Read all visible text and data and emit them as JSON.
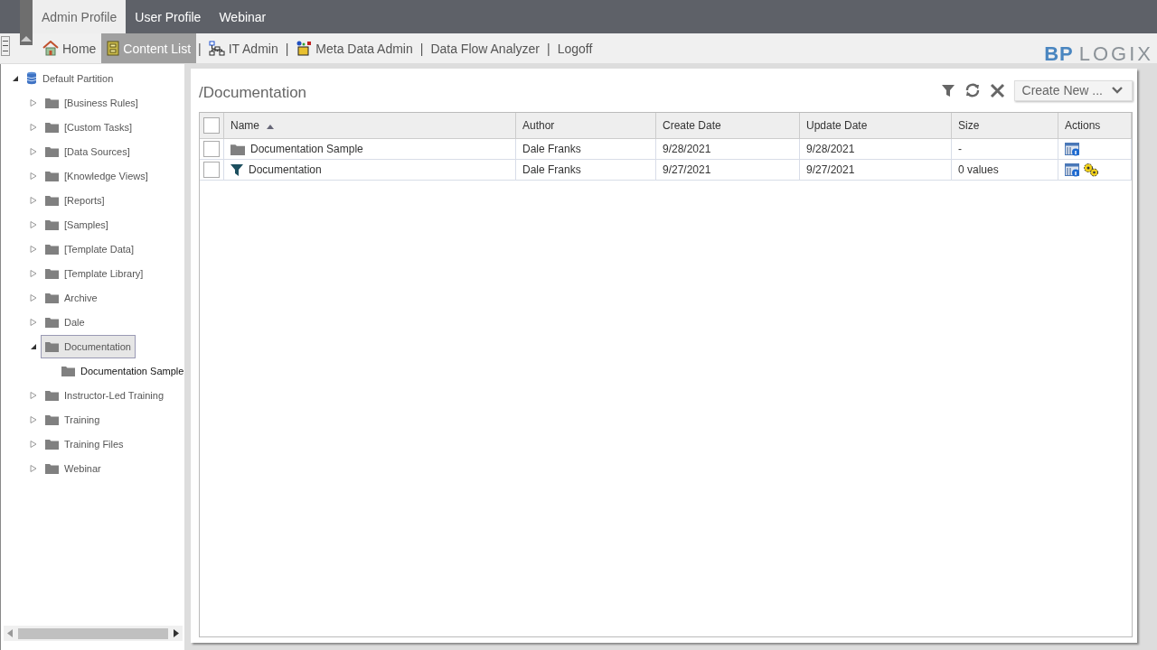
{
  "profile_tabs": [
    {
      "label": "Admin Profile",
      "selected": true
    },
    {
      "label": "User Profile",
      "selected": false
    },
    {
      "label": "Webinar",
      "selected": false
    }
  ],
  "nav_items": [
    {
      "label": "Home",
      "kind": "home",
      "selected": false
    },
    {
      "label": "Content List",
      "kind": "cabinet",
      "selected": true
    },
    {
      "label": "IT Admin",
      "kind": "network",
      "selected": false
    },
    {
      "label": "Meta Data Admin",
      "kind": "box",
      "selected": false
    },
    {
      "label": "Data Flow Analyzer",
      "kind": "plain",
      "selected": false
    },
    {
      "label": "Logoff",
      "kind": "plain",
      "selected": false
    }
  ],
  "nav_separator": "|",
  "logo": {
    "first": "BP",
    "second": "LOGIX"
  },
  "tree": {
    "label": "Default Partition",
    "expanded": true,
    "children": [
      {
        "label": "[Business Rules]",
        "expanded": false,
        "selected": false
      },
      {
        "label": "[Custom Tasks]",
        "expanded": false,
        "selected": false
      },
      {
        "label": "[Data Sources]",
        "expanded": false,
        "selected": false
      },
      {
        "label": "[Knowledge Views]",
        "expanded": false,
        "selected": false
      },
      {
        "label": "[Reports]",
        "expanded": false,
        "selected": false
      },
      {
        "label": "[Samples]",
        "expanded": false,
        "selected": false
      },
      {
        "label": "[Template Data]",
        "expanded": false,
        "selected": false
      },
      {
        "label": "[Template Library]",
        "expanded": false,
        "selected": false
      },
      {
        "label": "Archive",
        "expanded": false,
        "selected": false
      },
      {
        "label": "Dale",
        "expanded": false,
        "selected": false
      },
      {
        "label": "Documentation",
        "expanded": true,
        "selected": true,
        "children": [
          {
            "label": "Documentation Sample",
            "selected": false
          }
        ]
      },
      {
        "label": "Instructor-Led Training",
        "expanded": false,
        "selected": false
      },
      {
        "label": "Training",
        "expanded": false,
        "selected": false
      },
      {
        "label": "Training Files",
        "expanded": false,
        "selected": false
      },
      {
        "label": "Webinar",
        "expanded": false,
        "selected": false
      }
    ]
  },
  "content": {
    "path": "/Documentation",
    "create_button": "Create New ...",
    "select_all_checked": false,
    "columns": [
      {
        "label": "Name",
        "sorted": true
      },
      {
        "label": "Author",
        "sorted": false
      },
      {
        "label": "Create Date",
        "sorted": false
      },
      {
        "label": "Update Date",
        "sorted": false
      },
      {
        "label": "Size",
        "sorted": false
      },
      {
        "label": "Actions",
        "sorted": false
      }
    ],
    "rows": [
      {
        "checked": false,
        "kind": "folder",
        "name": "Documentation Sample",
        "author": "Dale Franks",
        "create_date": "9/28/2021",
        "update_date": "9/28/2021",
        "size": "-"
      },
      {
        "checked": false,
        "kind": "filter",
        "name": "Documentation",
        "author": "Dale Franks",
        "create_date": "9/27/2021",
        "update_date": "9/27/2021",
        "size": "0 values"
      }
    ]
  }
}
